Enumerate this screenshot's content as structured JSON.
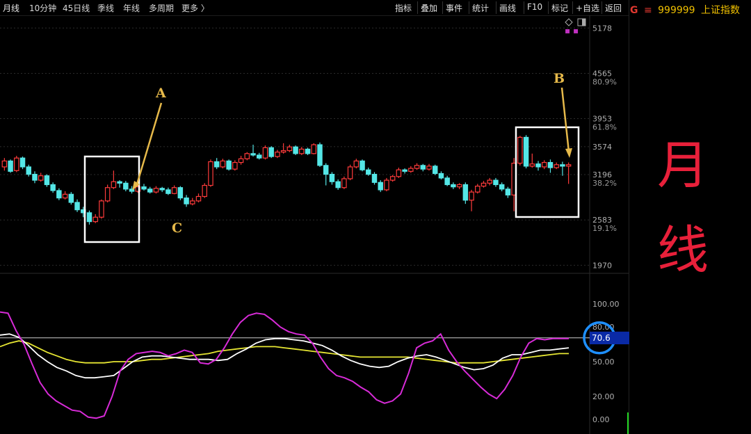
{
  "period_tabs": [
    "月线",
    "10分钟",
    "45日线",
    "季线",
    "年线",
    "多周期",
    "更多 〉"
  ],
  "toolbar": [
    "指标",
    "叠加",
    "事件",
    "统计",
    "画线",
    "F10",
    "标记",
    "+自选",
    "返回"
  ],
  "security": {
    "flag": "G",
    "menu_icon": "≡",
    "code": "999999",
    "name": "上证指数"
  },
  "side_title": [
    "月",
    "线"
  ],
  "price_axis": [
    "5178",
    "4565",
    "3953",
    "3574",
    "3196",
    "2583",
    "1970"
  ],
  "fib_axis": [
    "80.9%",
    "61.8%",
    "38.2%",
    "19.1%"
  ],
  "osc_axis": [
    "100.00",
    "80.00",
    "50.00",
    "20.00",
    "0.00"
  ],
  "osc_current": "70.6",
  "annotations": {
    "a": "A",
    "b": "B",
    "c": "C"
  },
  "colors": {
    "up": "#ff3b3b",
    "down": "#54e6e6",
    "magenta": "#d82bd8",
    "white": "#ffffff",
    "yellow": "#e6e633",
    "annotation": "#e6b94a",
    "accent_red": "#e8203a"
  },
  "chart_data": {
    "type": "candlestick",
    "price_axis_ticks": [
      5178,
      4565,
      3953,
      3574,
      3196,
      2583,
      1970
    ],
    "ylim": [
      1870,
      5350
    ],
    "candles": [
      [
        3300,
        3380,
        3420,
        3250
      ],
      [
        3380,
        3240,
        3400,
        3220
      ],
      [
        3250,
        3420,
        3450,
        3230
      ],
      [
        3420,
        3300,
        3440,
        3270
      ],
      [
        3300,
        3200,
        3330,
        3170
      ],
      [
        3200,
        3120,
        3240,
        3080
      ],
      [
        3120,
        3180,
        3220,
        3100
      ],
      [
        3180,
        3060,
        3200,
        3030
      ],
      [
        3060,
        2980,
        3090,
        2950
      ],
      [
        2980,
        2880,
        3010,
        2850
      ],
      [
        2880,
        2930,
        2970,
        2860
      ],
      [
        2930,
        2820,
        2960,
        2790
      ],
      [
        2820,
        2720,
        2860,
        2690
      ],
      [
        2720,
        2680,
        2760,
        2620
      ],
      [
        2680,
        2560,
        2710,
        2520
      ],
      [
        2560,
        2620,
        2660,
        2540
      ],
      [
        2620,
        2840,
        2860,
        2600
      ],
      [
        2840,
        3020,
        3060,
        2820
      ],
      [
        3020,
        3100,
        3250,
        3000
      ],
      [
        3100,
        3080,
        3120,
        3020
      ],
      [
        3080,
        3000,
        3110,
        2970
      ],
      [
        3000,
        2970,
        3040,
        2940
      ],
      [
        2970,
        3030,
        3060,
        2950
      ],
      [
        3030,
        3000,
        3070,
        2980
      ],
      [
        3000,
        2960,
        3030,
        2940
      ],
      [
        2960,
        3010,
        3040,
        2940
      ],
      [
        3010,
        2990,
        3030,
        2960
      ],
      [
        2990,
        2940,
        3020,
        2920
      ],
      [
        2940,
        3020,
        3050,
        2930
      ],
      [
        3020,
        2880,
        3040,
        2850
      ],
      [
        2880,
        2800,
        2920,
        2760
      ],
      [
        2800,
        2840,
        2880,
        2780
      ],
      [
        2840,
        2900,
        2940,
        2820
      ],
      [
        2900,
        3050,
        3080,
        2880
      ],
      [
        3050,
        3370,
        3400,
        3030
      ],
      [
        3370,
        3300,
        3420,
        3270
      ],
      [
        3300,
        3380,
        3410,
        3280
      ],
      [
        3380,
        3270,
        3400,
        3250
      ],
      [
        3270,
        3360,
        3390,
        3250
      ],
      [
        3360,
        3410,
        3450,
        3330
      ],
      [
        3410,
        3480,
        3500,
        3390
      ],
      [
        3480,
        3460,
        3600,
        3440
      ],
      [
        3460,
        3420,
        3490,
        3400
      ],
      [
        3420,
        3560,
        3590,
        3400
      ],
      [
        3560,
        3440,
        3580,
        3420
      ],
      [
        3440,
        3500,
        3530,
        3420
      ],
      [
        3500,
        3520,
        3620,
        3480
      ],
      [
        3520,
        3570,
        3600,
        3500
      ],
      [
        3570,
        3480,
        3590,
        3460
      ],
      [
        3480,
        3540,
        3570,
        3460
      ],
      [
        3540,
        3480,
        3560,
        3460
      ],
      [
        3480,
        3600,
        3620,
        3470
      ],
      [
        3600,
        3320,
        3630,
        3300
      ],
      [
        3320,
        3200,
        3350,
        3050
      ],
      [
        3200,
        3100,
        3230,
        3060
      ],
      [
        3100,
        3020,
        3130,
        2990
      ],
      [
        3020,
        3140,
        3170,
        3000
      ],
      [
        3140,
        3300,
        3330,
        3120
      ],
      [
        3300,
        3380,
        3410,
        3280
      ],
      [
        3380,
        3260,
        3400,
        3240
      ],
      [
        3260,
        3200,
        3290,
        3180
      ],
      [
        3200,
        3090,
        3230,
        3060
      ],
      [
        3090,
        2990,
        3120,
        2960
      ],
      [
        2990,
        3120,
        3150,
        2970
      ],
      [
        3120,
        3170,
        3190,
        3100
      ],
      [
        3170,
        3260,
        3290,
        3150
      ],
      [
        3260,
        3240,
        3280,
        3210
      ],
      [
        3240,
        3280,
        3310,
        3220
      ],
      [
        3280,
        3320,
        3350,
        3260
      ],
      [
        3320,
        3270,
        3340,
        3240
      ],
      [
        3270,
        3310,
        3340,
        3250
      ],
      [
        3310,
        3210,
        3330,
        3190
      ],
      [
        3210,
        3150,
        3240,
        3130
      ],
      [
        3150,
        3060,
        3180,
        3040
      ],
      [
        3060,
        3030,
        3090,
        3000
      ],
      [
        3030,
        3060,
        3080,
        3000
      ],
      [
        3060,
        2850,
        3090,
        2800
      ],
      [
        2850,
        2960,
        2990,
        2700
      ],
      [
        2960,
        3040,
        3070,
        2940
      ],
      [
        3040,
        3080,
        3110,
        3020
      ],
      [
        3080,
        3120,
        3150,
        3050
      ],
      [
        3120,
        3060,
        3150,
        3030
      ],
      [
        3060,
        3000,
        3090,
        2970
      ],
      [
        3000,
        2920,
        3030,
        2880
      ],
      [
        2920,
        3350,
        3420,
        2700
      ],
      [
        3350,
        3700,
        3720,
        3320
      ],
      [
        3700,
        3310,
        3730,
        3280
      ],
      [
        3310,
        3340,
        3480,
        3290
      ],
      [
        3340,
        3300,
        3380,
        3250
      ],
      [
        3300,
        3360,
        3390,
        3270
      ],
      [
        3360,
        3290,
        3400,
        3220
      ],
      [
        3290,
        3330,
        3360,
        3270
      ],
      [
        3330,
        3310,
        3370,
        3180
      ],
      [
        3310,
        3330,
        3360,
        3070
      ]
    ],
    "oscillator": {
      "ylim": [
        0,
        100
      ],
      "ticks": [
        100,
        80,
        50,
        20,
        0
      ],
      "reference_level": 70.6,
      "magenta": [
        93,
        92,
        77,
        65,
        48,
        32,
        22,
        16,
        12,
        8,
        7,
        2,
        1,
        3,
        20,
        42,
        52,
        57,
        58,
        59,
        58,
        55,
        57,
        60,
        58,
        49,
        48,
        52,
        62,
        74,
        84,
        90,
        92,
        91,
        86,
        80,
        76,
        74,
        73,
        66,
        54,
        44,
        38,
        36,
        33,
        28,
        24,
        17,
        14,
        16,
        22,
        40,
        62,
        66,
        68,
        74,
        60,
        50,
        42,
        35,
        28,
        22,
        18,
        26,
        38,
        54,
        66,
        70,
        69,
        70,
        70,
        70
      ],
      "white": [
        73,
        74,
        71,
        64,
        56,
        50,
        45,
        42,
        38,
        36,
        36,
        37,
        38,
        44,
        50,
        54,
        55,
        55,
        54,
        53,
        52,
        52,
        52,
        51,
        52,
        57,
        61,
        66,
        69,
        70,
        70,
        69,
        68,
        66,
        64,
        60,
        55,
        51,
        48,
        46,
        45,
        46,
        50,
        53,
        55,
        56,
        54,
        51,
        48,
        45,
        43,
        44,
        47,
        53,
        56,
        56,
        58,
        60,
        60,
        61,
        62
      ],
      "yellow": [
        63,
        66,
        68,
        66,
        62,
        58,
        55,
        52,
        50,
        49,
        49,
        49,
        50,
        50,
        50,
        51,
        52,
        52,
        53,
        54,
        55,
        56,
        57,
        59,
        60,
        61,
        62,
        63,
        63,
        63,
        62,
        61,
        60,
        59,
        58,
        57,
        56,
        55,
        54,
        54,
        54,
        54,
        54,
        54,
        53,
        52,
        51,
        50,
        49,
        49,
        49,
        49,
        50,
        51,
        52,
        53,
        54,
        55,
        56,
        57,
        57
      ]
    }
  }
}
